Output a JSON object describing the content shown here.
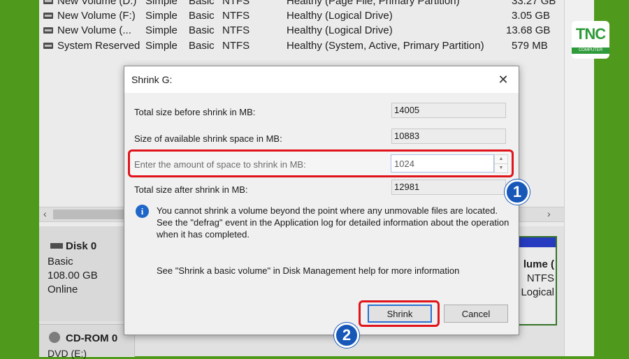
{
  "volumes": [
    {
      "name": "New Volume (D:)",
      "layout": "Simple",
      "type": "Basic",
      "fs": "NTFS",
      "status": "Healthy (Page File, Primary Partition)",
      "capacity": "33.27 GB"
    },
    {
      "name": "New Volume (F:)",
      "layout": "Simple",
      "type": "Basic",
      "fs": "NTFS",
      "status": "Healthy (Logical Drive)",
      "capacity": "3.05 GB"
    },
    {
      "name": "New Volume (...",
      "layout": "Simple",
      "type": "Basic",
      "fs": "NTFS",
      "status": "Healthy (Logical Drive)",
      "capacity": "13.68 GB"
    },
    {
      "name": "System Reserved",
      "layout": "Simple",
      "type": "Basic",
      "fs": "NTFS",
      "status": "Healthy (System, Active, Primary Partition)",
      "capacity": "579 MB"
    }
  ],
  "scroll": {
    "left_arrow": "‹",
    "right_arrow": "›"
  },
  "disk0": {
    "name": "Disk 0",
    "type": "Basic",
    "size": "108.00 GB",
    "status": "Online"
  },
  "cdrom": {
    "name": "CD-ROM 0",
    "drive": "DVD (E:)"
  },
  "partition": {
    "line1": "lume (",
    "line2": "NTFS",
    "line3": "Logical"
  },
  "dialog": {
    "title": "Shrink G:",
    "close": "✕",
    "total_before_label": "Total size before shrink in MB:",
    "total_before_value": "14005",
    "available_label": "Size of available shrink space in MB:",
    "available_value": "10883",
    "amount_label": "Enter the amount of space to shrink in MB:",
    "amount_value": "1024",
    "total_after_label": "Total size after shrink in MB:",
    "total_after_value": "12981",
    "info_text": "You cannot shrink a volume beyond the point where any unmovable files are located. See the \"defrag\" event in the Application log for detailed information about the operation when it has completed.",
    "help_text": "See \"Shrink a basic volume\" in Disk Management help for more information",
    "shrink_button": "Shrink",
    "cancel_button": "Cancel"
  },
  "badges": {
    "step1": "1",
    "step2": "2"
  },
  "logo": {
    "text": "TNC",
    "sub": "COMPUTER"
  },
  "colors": {
    "highlight": "#e0141b",
    "badge": "#1657b8",
    "background": "#4f9a1c"
  }
}
